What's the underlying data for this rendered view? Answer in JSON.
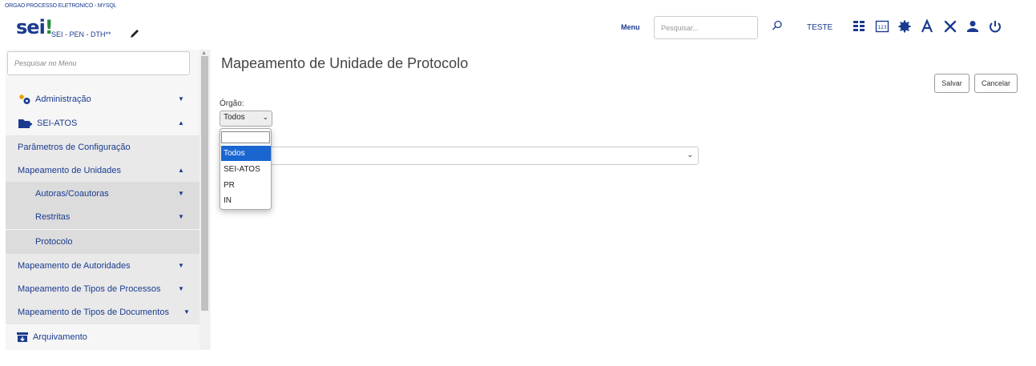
{
  "header": {
    "org_title": "ORGAO PROCESSO ELETRONICO - MYSQL",
    "logo_text": "sei",
    "logo_mark": "!",
    "system_name": "SEI - PEN - DTH**",
    "menu_label": "Menu",
    "search_placeholder": "Pesquisar...",
    "user_name": "TESTE",
    "icons": [
      "search-icon",
      "grid-icon",
      "numbers-icon",
      "gear-badge-icon",
      "font-icon",
      "tools-icon",
      "user-icon",
      "power-icon"
    ]
  },
  "sidebar": {
    "search_placeholder": "Pesquisar no Menu",
    "items": [
      {
        "label": "Administração",
        "icon": "gears-icon",
        "caret": "down"
      },
      {
        "label": "SEI-ATOS",
        "icon": "folder-icon",
        "caret": "up"
      },
      {
        "label": "Parâmetros de Configuração"
      },
      {
        "label": "Mapeamento de Unidades",
        "caret": "up"
      },
      {
        "label": "Autoras/Coautoras",
        "caret": "down"
      },
      {
        "label": "Restritas",
        "caret": "down"
      },
      {
        "label": "Protocolo"
      },
      {
        "label": "Mapeamento de Autoridades",
        "caret": "down"
      },
      {
        "label": "Mapeamento de Tipos de Processos",
        "caret": "down"
      },
      {
        "label": "Mapeamento de Tipos de Documentos",
        "caret": "down"
      },
      {
        "label": "Arquivamento",
        "icon": "archive-icon"
      }
    ]
  },
  "main": {
    "title": "Mapeamento de Unidade de Protocolo",
    "save_label": "Salvar",
    "cancel_label": "Cancelar",
    "orgao_label": "Órgão:",
    "orgao_selected": "Todos",
    "orgao_options": [
      "Todos",
      "SEI-ATOS",
      "PR",
      "IN"
    ]
  },
  "colors": {
    "brand": "#1a3b8f",
    "accent_green": "#2b8a3e",
    "selected_option": "#1a66d0"
  }
}
